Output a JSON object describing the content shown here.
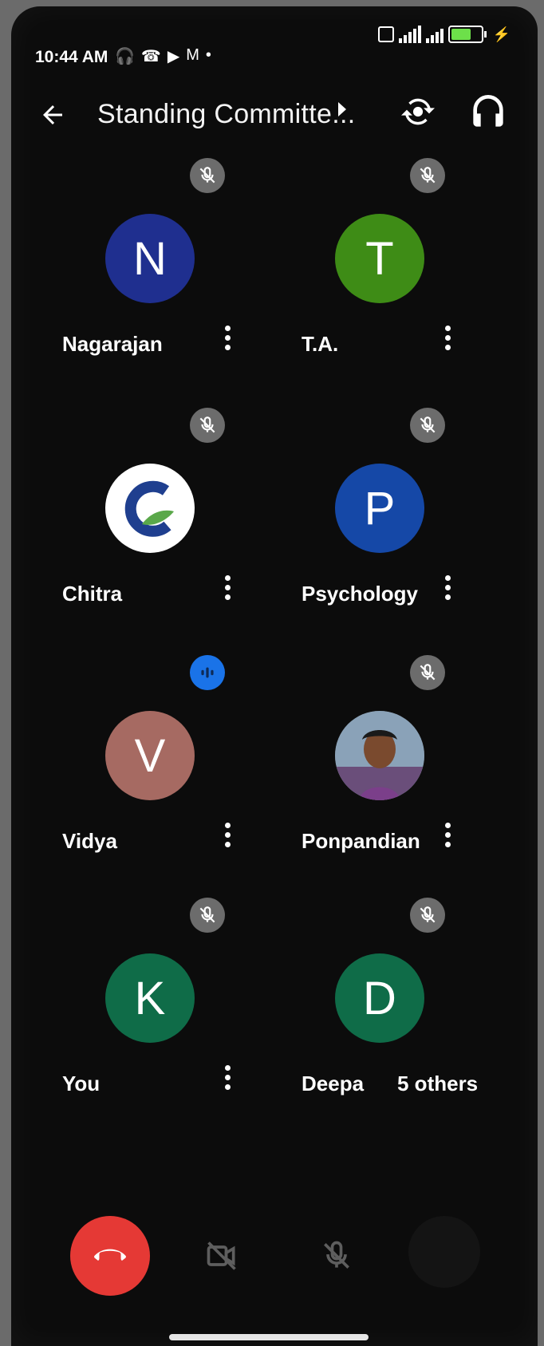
{
  "status": {
    "time": "10:44 AM",
    "left_icons": [
      "headphones-icon",
      "whatsapp-icon",
      "meet-icon",
      "gmail-icon",
      "dot-icon"
    ],
    "right_icons": [
      "sim-icon",
      "signal-icon",
      "signal-icon",
      "battery-icon",
      "charging-icon"
    ],
    "battery_level": 0.6
  },
  "header": {
    "title": "Standing Committe...",
    "icons": [
      "back-arrow-icon",
      "switch-camera-icon",
      "headphones-icon"
    ]
  },
  "participants": [
    {
      "name": "Nagarajan",
      "initial": "N",
      "color": "#1f2f8f",
      "mic": "muted"
    },
    {
      "name": "T.A.",
      "initial": "T",
      "color": "#3e8c16",
      "mic": "muted"
    },
    {
      "name": "Chitra",
      "initial": "",
      "color": "#ffffff",
      "mic": "muted",
      "avatar": "logo"
    },
    {
      "name": "Psychology",
      "initial": "P",
      "color": "#1548a7",
      "mic": "muted"
    },
    {
      "name": "Vidya",
      "initial": "V",
      "color": "#a66a62",
      "mic": "speaking"
    },
    {
      "name": "Ponpandian",
      "initial": "",
      "color": "#6a6e72",
      "mic": "muted",
      "avatar": "photo"
    },
    {
      "name": "You",
      "initial": "K",
      "color": "#0f6c48",
      "mic": "muted"
    },
    {
      "name": "Deepa",
      "initial": "D",
      "color": "#0f6c48",
      "mic": "muted",
      "extra": "5 others"
    }
  ],
  "controls": {
    "icons": [
      "end-call-icon",
      "camera-off-icon",
      "mic-off-icon",
      "more-options-icon"
    ],
    "end_call_color": "#e53935"
  }
}
